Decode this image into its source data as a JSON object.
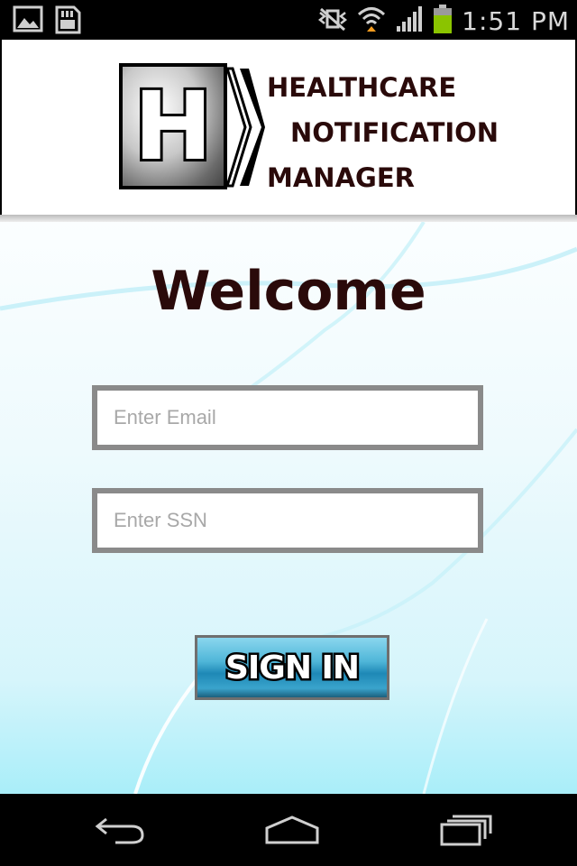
{
  "status_bar": {
    "time": "1:51 PM",
    "icons": [
      "image-icon",
      "sd-card-icon",
      "mute-vibrate-icon",
      "wifi-icon",
      "signal-icon",
      "battery-icon"
    ],
    "battery_color": "#8bc400"
  },
  "header": {
    "logo_letter": "H",
    "brand_lines": [
      "HEALTHCARE",
      "NOTIFICATION",
      "MANAGER"
    ],
    "brand_color": "#2a0a0a"
  },
  "main": {
    "welcome": "Welcome",
    "email": {
      "placeholder": "Enter Email",
      "value": ""
    },
    "ssn": {
      "placeholder": "Enter SSN",
      "value": ""
    },
    "signin_label": "SIGN IN"
  },
  "nav_bar": {
    "icons": [
      "back-icon",
      "home-icon",
      "recent-apps-icon"
    ]
  }
}
